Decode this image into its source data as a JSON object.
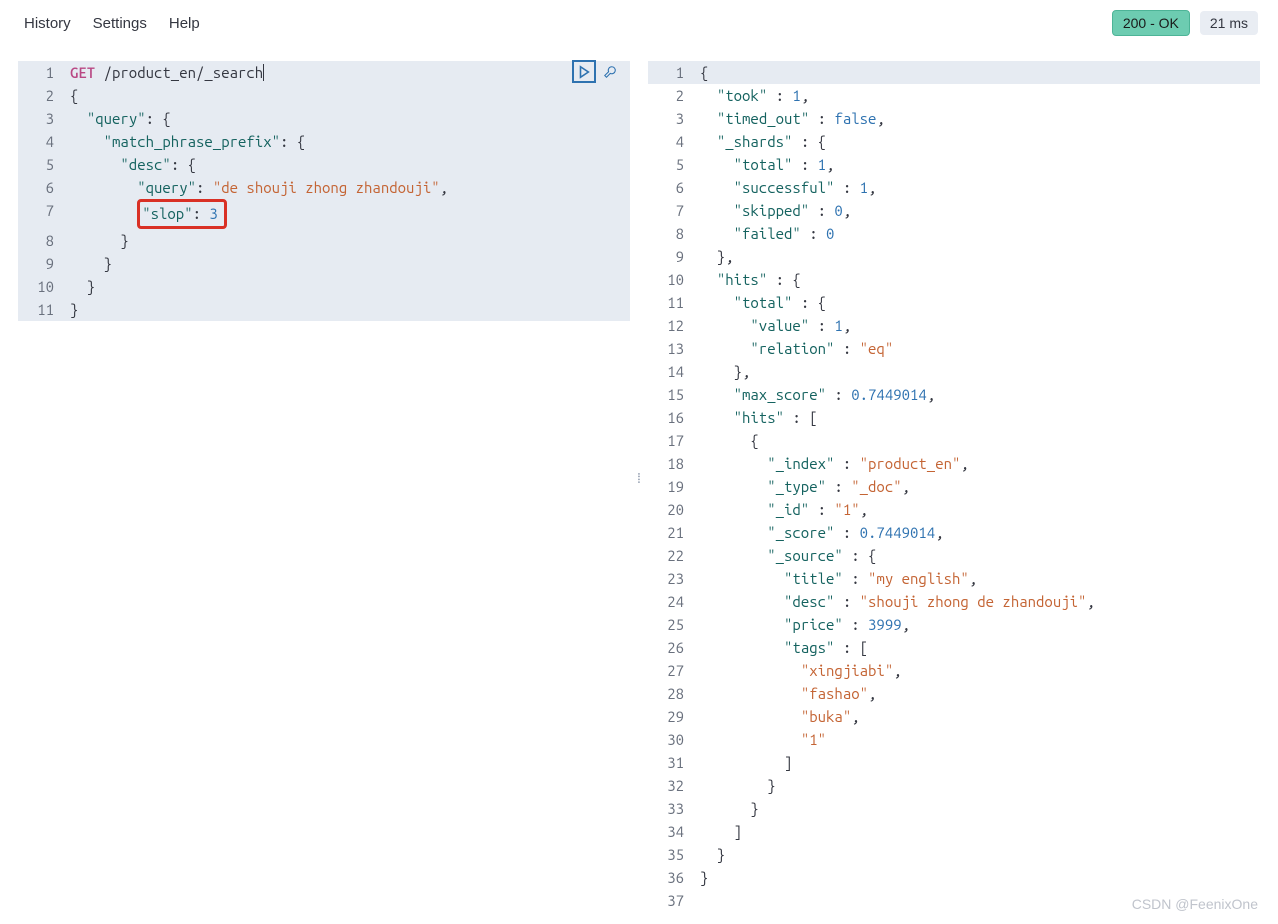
{
  "menu": {
    "history": "History",
    "settings": "Settings",
    "help": "Help"
  },
  "status": {
    "ok": "200 - OK",
    "time": "21 ms"
  },
  "watermark": "CSDN @FeenixOne",
  "request": {
    "method": "GET",
    "path": "/product_en/_search",
    "body": {
      "query": {
        "match_phrase_prefix": {
          "desc": {
            "query": "de shouji zhong zhandouji",
            "slop": 3
          }
        }
      }
    },
    "lines": [
      "1",
      "2",
      "3",
      "4",
      "5",
      "6",
      "7",
      "8",
      "9",
      "10",
      "11"
    ]
  },
  "response": {
    "body": {
      "took": 1,
      "timed_out": false,
      "_shards": {
        "total": 1,
        "successful": 1,
        "skipped": 0,
        "failed": 0
      },
      "hits": {
        "total": {
          "value": 1,
          "relation": "eq"
        },
        "max_score": 0.7449014,
        "hits": [
          {
            "_index": "product_en",
            "_type": "_doc",
            "_id": "1",
            "_score": 0.7449014,
            "_source": {
              "title": "my english",
              "desc": "shouji zhong de zhandouji",
              "price": 3999,
              "tags": [
                "xingjiabi",
                "fashao",
                "buka",
                "1"
              ]
            }
          }
        ]
      }
    },
    "lines": [
      "1",
      "2",
      "3",
      "4",
      "5",
      "6",
      "7",
      "8",
      "9",
      "10",
      "11",
      "12",
      "13",
      "14",
      "15",
      "16",
      "17",
      "18",
      "19",
      "20",
      "21",
      "22",
      "23",
      "24",
      "25",
      "26",
      "27",
      "28",
      "29",
      "30",
      "31",
      "32",
      "33",
      "34",
      "35",
      "36",
      "37"
    ]
  },
  "tok": {
    "query": "\"query\"",
    "mpp": "\"match_phrase_prefix\"",
    "desc": "\"desc\"",
    "slop": "\"slop\"",
    "queryval": "\"de shouji zhong zhandouji\"",
    "slopval": "3",
    "took": "\"took\"",
    "timed_out": "\"timed_out\"",
    "shards": "\"_shards\"",
    "total": "\"total\"",
    "successful": "\"successful\"",
    "skipped": "\"skipped\"",
    "failed": "\"failed\"",
    "hits": "\"hits\"",
    "value": "\"value\"",
    "relation": "\"relation\"",
    "max_score": "\"max_score\"",
    "index": "\"_index\"",
    "type": "\"_type\"",
    "id": "\"_id\"",
    "score": "\"_score\"",
    "source": "\"_source\"",
    "title": "\"title\"",
    "desc2": "\"desc\"",
    "price": "\"price\"",
    "tags": "\"tags\"",
    "v_took": "1",
    "v_false": "false",
    "v_1": "1",
    "v_0": "0",
    "v_eq": "\"eq\"",
    "v_ms": "0.7449014",
    "v_pe": "\"product_en\"",
    "v_doc": "\"_doc\"",
    "v_id1": "\"1\"",
    "v_title": "\"my english\"",
    "v_desc": "\"shouji zhong de zhandouji\"",
    "v_price": "3999",
    "v_t1": "\"xingjiabi\"",
    "v_t2": "\"fashao\"",
    "v_t3": "\"buka\"",
    "v_t4": "\"1\""
  }
}
